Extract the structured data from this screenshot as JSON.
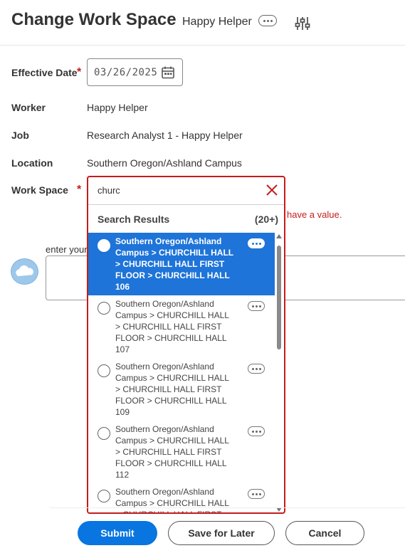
{
  "header": {
    "title": "Change Work Space",
    "worker_name": "Happy Helper",
    "related_actions_icon": "ellipsis-icon",
    "settings_icon": "sliders-icon"
  },
  "form": {
    "effective_date": {
      "label": "Effective Date",
      "value": "03/26/2025",
      "icon": "calendar-icon"
    },
    "worker": {
      "label": "Worker",
      "value": "Happy Helper"
    },
    "job": {
      "label": "Job",
      "value": "Research Analyst 1 - Happy Helper"
    },
    "location": {
      "label": "Location",
      "value": "Southern Oregon/Ashland Campus"
    },
    "work_space": {
      "label": "Work Space",
      "search_value": "churc"
    },
    "required_marker": "*",
    "error_text": "have a value.",
    "comment_label": "enter your"
  },
  "search": {
    "results_title": "Search Results",
    "results_count": "(20+)",
    "options": [
      {
        "lines": [
          "Southern Oregon/Ashland",
          "Campus > CHURCHILL HALL",
          "> CHURCHILL HALL FIRST",
          "FLOOR > CHURCHILL HALL",
          "106"
        ],
        "selected": true
      },
      {
        "lines": [
          "Southern Oregon/Ashland",
          "Campus > CHURCHILL HALL",
          "> CHURCHILL HALL FIRST",
          "FLOOR > CHURCHILL HALL",
          "107"
        ],
        "selected": false
      },
      {
        "lines": [
          "Southern Oregon/Ashland",
          "Campus > CHURCHILL HALL",
          "> CHURCHILL HALL FIRST",
          "FLOOR > CHURCHILL HALL",
          "109"
        ],
        "selected": false
      },
      {
        "lines": [
          "Southern Oregon/Ashland",
          "Campus > CHURCHILL HALL",
          "> CHURCHILL HALL FIRST",
          "FLOOR > CHURCHILL HALL",
          "112"
        ],
        "selected": false
      },
      {
        "lines": [
          "Southern Oregon/Ashland",
          "Campus > CHURCHILL HALL",
          "> CHURCHILL HALL FIRST"
        ],
        "selected": false
      }
    ]
  },
  "footer": {
    "submit": "Submit",
    "save_later": "Save for Later",
    "cancel": "Cancel"
  },
  "colors": {
    "accent": "#0875e1",
    "selected_row": "#1e74d8",
    "error": "#c41c1c"
  }
}
